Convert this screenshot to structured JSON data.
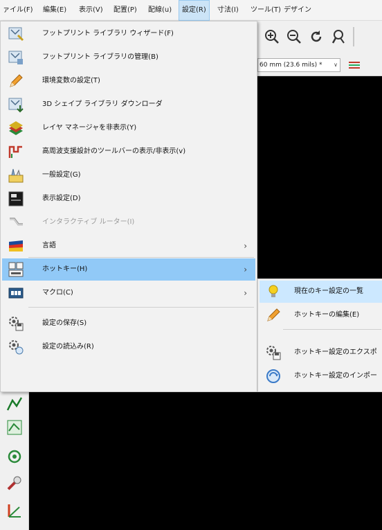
{
  "menubar": [
    {
      "label": "ァイル(F)",
      "active": false
    },
    {
      "label": "編集(E)",
      "active": false
    },
    {
      "label": "表示(V)",
      "active": false
    },
    {
      "label": "配置(P)",
      "active": false
    },
    {
      "label": "配線(u)",
      "active": false
    },
    {
      "label": "設定(R)",
      "active": true
    },
    {
      "label": "寸法(I)",
      "active": false
    },
    {
      "label": "ツール(T)",
      "active": false
    },
    {
      "label": "デザイン",
      "active": false
    }
  ],
  "toolbar": {
    "grid_value": "60 mm (23.6 mils) *",
    "icons": [
      "zoom-in-icon",
      "zoom-out-icon",
      "redraw-icon",
      "zoom-fit-icon"
    ]
  },
  "settings_menu": {
    "items": [
      {
        "label": "フットプリント ライブラリ ウィザード(F)",
        "icon": "footprint-wizard-icon",
        "has_submenu": false,
        "disabled": false,
        "highlighted": false
      },
      {
        "label": "フットプリント ライブラリの管理(B)",
        "icon": "footprint-library-icon",
        "has_submenu": false,
        "disabled": false,
        "highlighted": false
      },
      {
        "label": "環境変数の設定(T)",
        "icon": "pencil-icon",
        "has_submenu": false,
        "disabled": false,
        "highlighted": false
      },
      {
        "label": "3D シェイプ ライブラリ ダウンローダ",
        "icon": "3d-download-icon",
        "has_submenu": false,
        "disabled": false,
        "highlighted": false
      },
      {
        "label": "レイヤ マネージャを非表示(Y)",
        "icon": "layer-manager-icon",
        "has_submenu": false,
        "disabled": false,
        "highlighted": false
      },
      {
        "label": "高周波支援設計のツールバーの表示/非表示(v)",
        "icon": "rf-toolbar-icon",
        "has_submenu": false,
        "disabled": false,
        "highlighted": false
      },
      {
        "label": "一般設定(G)",
        "icon": "general-settings-icon",
        "has_submenu": false,
        "disabled": false,
        "highlighted": false
      },
      {
        "label": "表示設定(D)",
        "icon": "display-settings-icon",
        "has_submenu": false,
        "disabled": false,
        "highlighted": false
      },
      {
        "label": "インタラクティブ ルーター(I)",
        "icon": "interactive-router-icon",
        "has_submenu": false,
        "disabled": true,
        "highlighted": false
      },
      {
        "label": "言語",
        "icon": "language-flag-icon",
        "has_submenu": true,
        "disabled": false,
        "highlighted": false
      },
      {
        "label": "ホットキー(H)",
        "icon": "hotkey-icon",
        "has_submenu": true,
        "disabled": false,
        "highlighted": true
      },
      {
        "label": "マクロ(C)",
        "icon": "macro-icon",
        "has_submenu": true,
        "disabled": false,
        "highlighted": false
      },
      {
        "label": "設定の保存(S)",
        "icon": "save-settings-icon",
        "has_submenu": false,
        "disabled": false,
        "highlighted": false
      },
      {
        "label": "設定の読込み(R)",
        "icon": "load-settings-icon",
        "has_submenu": false,
        "disabled": false,
        "highlighted": false
      }
    ]
  },
  "hotkey_submenu": {
    "items": [
      {
        "label": "現在のキー設定の一覧",
        "icon": "lightbulb-icon",
        "highlighted": true
      },
      {
        "label": "ホットキーの編集(E)",
        "icon": "pencil-icon",
        "highlighted": false
      },
      {
        "label": "ホットキー設定のエクスポ",
        "icon": "export-hotkeys-icon",
        "highlighted": false
      },
      {
        "label": "ホットキー設定のインポー",
        "icon": "import-hotkeys-icon",
        "highlighted": false
      }
    ]
  },
  "colors": {
    "menu_bg": "#f2f2f2",
    "highlight": "#91c9f7",
    "submenu_highlight": "#cce8ff",
    "canvas": "#000000",
    "disabled_text": "#9a9a9a"
  }
}
